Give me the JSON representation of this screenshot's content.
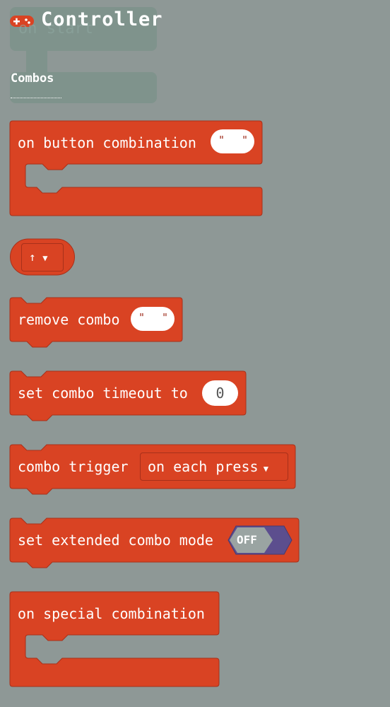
{
  "category": {
    "title": "Controller",
    "icon": "gamepad-icon",
    "color": "#d94323"
  },
  "ghost_block": "on start",
  "section_label": "Combos",
  "colors": {
    "block": "#d94323",
    "block_border": "#a8301a",
    "background": "#8e9896",
    "toggle": "#5c4e8e"
  },
  "blocks": {
    "on_button_combination": {
      "label": "on button combination",
      "value": ""
    },
    "arrow_dropdown": {
      "value": "↑"
    },
    "remove_combo": {
      "label": "remove combo",
      "value": ""
    },
    "set_combo_timeout": {
      "label": "set combo timeout to",
      "value": "0"
    },
    "combo_trigger": {
      "label": "combo trigger",
      "value": "on each press"
    },
    "set_extended_combo_mode": {
      "label": "set extended combo mode",
      "value": "OFF"
    },
    "on_special_combination": {
      "label": "on special combination"
    }
  }
}
